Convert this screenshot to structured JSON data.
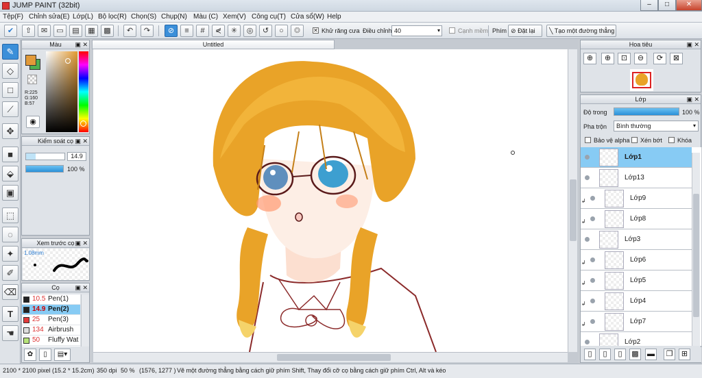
{
  "window": {
    "title": "JUMP PAINT (32bit)",
    "buttons": [
      "–",
      "□",
      "✕"
    ]
  },
  "menu": [
    "Tệp(F)",
    "Chỉnh sửa(E)",
    "Lớp(L)",
    "Bộ lọc(R)",
    "Chọn(S)",
    "Chụp(N)",
    "Màu (C)",
    "Xem(V)",
    "Công cụ(T)",
    "Cửa sổ(W)",
    "Help"
  ],
  "toolbar": {
    "antialias_label": "Khử răng cưa",
    "adjust_label": "Điều chỉnh",
    "adjust_value": "40",
    "smooth_label": "Cạnh mềm",
    "key_label": "Phím",
    "reset_label": "Đặt lại",
    "straight_line_label": "Tạo một đường thẳng"
  },
  "color_panel": {
    "title": "Màu",
    "r": "R:225",
    "g": "G:160",
    "b": "B:57",
    "fg_color": "#e19a39",
    "bg_color": "#4caf50"
  },
  "brush_control": {
    "title": "Kiểm soát cọ",
    "size": "14.9",
    "opacity": "100 %",
    "opacity_fraction": 1.0
  },
  "brush_preview": {
    "title": "Xem trước cọ",
    "size_label": "1.08mm"
  },
  "brush_list": {
    "title": "Cọ",
    "items": [
      {
        "size": "10.5",
        "name": "Pen(1)",
        "color": "#222222"
      },
      {
        "size": "14.9",
        "name": "Pen(2)",
        "color": "#222222",
        "selected": true
      },
      {
        "size": "25",
        "name": "Pen(3)",
        "color": "#e23b3b"
      },
      {
        "size": "134",
        "name": "Airbrush",
        "color": "#dddddd"
      },
      {
        "size": "50",
        "name": "Fluffy Wat",
        "color": "#b6e37a"
      }
    ]
  },
  "document": {
    "tab_title": "Untitled"
  },
  "navigator": {
    "title": "Hoa tiêu"
  },
  "layers_panel": {
    "title": "Lớp",
    "opacity_label": "Độ trong",
    "opacity_value": "100 %",
    "opacity_fraction": 1.0,
    "blend_label": "Pha trộn",
    "blend_value": "Bình thường",
    "protect_alpha": "Bảo vệ alpha",
    "clip": "Xén bớt",
    "lock": "Khóa",
    "layers": [
      {
        "name": "Lớp1",
        "selected": true,
        "indent": false
      },
      {
        "name": "Lớp13",
        "indent": false
      },
      {
        "name": "Lớp9",
        "indent": true
      },
      {
        "name": "Lớp8",
        "indent": true
      },
      {
        "name": "Lớp3",
        "indent": false
      },
      {
        "name": "Lớp6",
        "indent": true
      },
      {
        "name": "Lớp5",
        "indent": true
      },
      {
        "name": "Lớp4",
        "indent": true
      },
      {
        "name": "Lớp7",
        "indent": true
      },
      {
        "name": "Lớp2",
        "indent": false
      }
    ]
  },
  "status": {
    "size": "2100 * 2100 pixel",
    "cm": "(15.2 * 15.2cm)",
    "dpi": "350 dpi",
    "zoom": "50 %",
    "coords": "(1576, 1277 )",
    "hint": "Vẽ một đường thẳng bằng cách giữ phím Shift, Thay đổi cỡ cọ bằng cách giữ phím Ctrl, Alt và kéo"
  }
}
